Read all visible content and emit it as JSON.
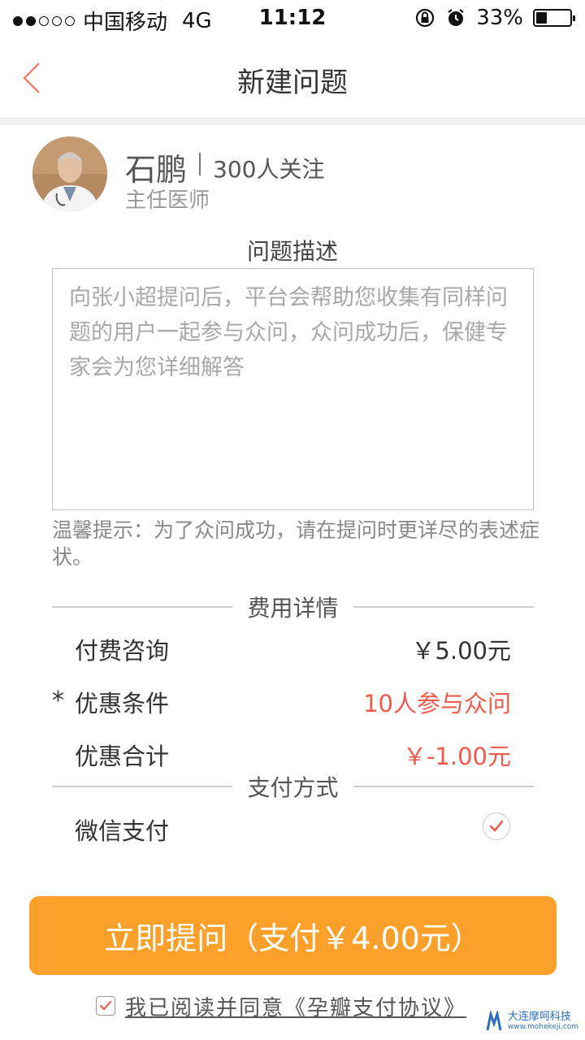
{
  "status_bar": {
    "carrier": "中国移动",
    "network": "4G",
    "time": "11:12",
    "battery": "33%",
    "battery_level": 0.33,
    "signal_filled": 2,
    "signal_total": 5
  },
  "nav": {
    "title": "新建问题"
  },
  "doctor": {
    "name": "石鹏",
    "followers": "300人关注",
    "title": "主任医师"
  },
  "question": {
    "section_label": "问题描述",
    "placeholder": "向张小超提问后，平台会帮助您收集有同样问题的用户一起参与众问，众问成功后，保健专家会为您详细解答",
    "value": "",
    "tip": "温馨提示：为了众问成功，请在提问时更详尽的表述症状。"
  },
  "fees": {
    "section_label": "费用详情",
    "rows": [
      {
        "label": "付费咨询",
        "value": "￥5.00元",
        "required": false
      },
      {
        "label": "优惠条件",
        "value": "10人参与众问",
        "required": true
      },
      {
        "label": "优惠合计",
        "value": "￥-1.00元",
        "required": false
      }
    ],
    "required_mark": "*"
  },
  "payment": {
    "section_label": "支付方式",
    "method": "微信支付",
    "selected": true
  },
  "submit": {
    "label": "立即提问（支付￥4.00元）"
  },
  "agreement": {
    "prefix": "我已阅读并同意",
    "link": "《孕瓣支付协议》",
    "checked": true
  },
  "watermark": {
    "name": "大连摩呵科技",
    "site": "www.mohekeji.com"
  },
  "colors": {
    "accent": "#fba02a",
    "highlight": "#f05a4a",
    "back_arrow": "#f08070"
  }
}
